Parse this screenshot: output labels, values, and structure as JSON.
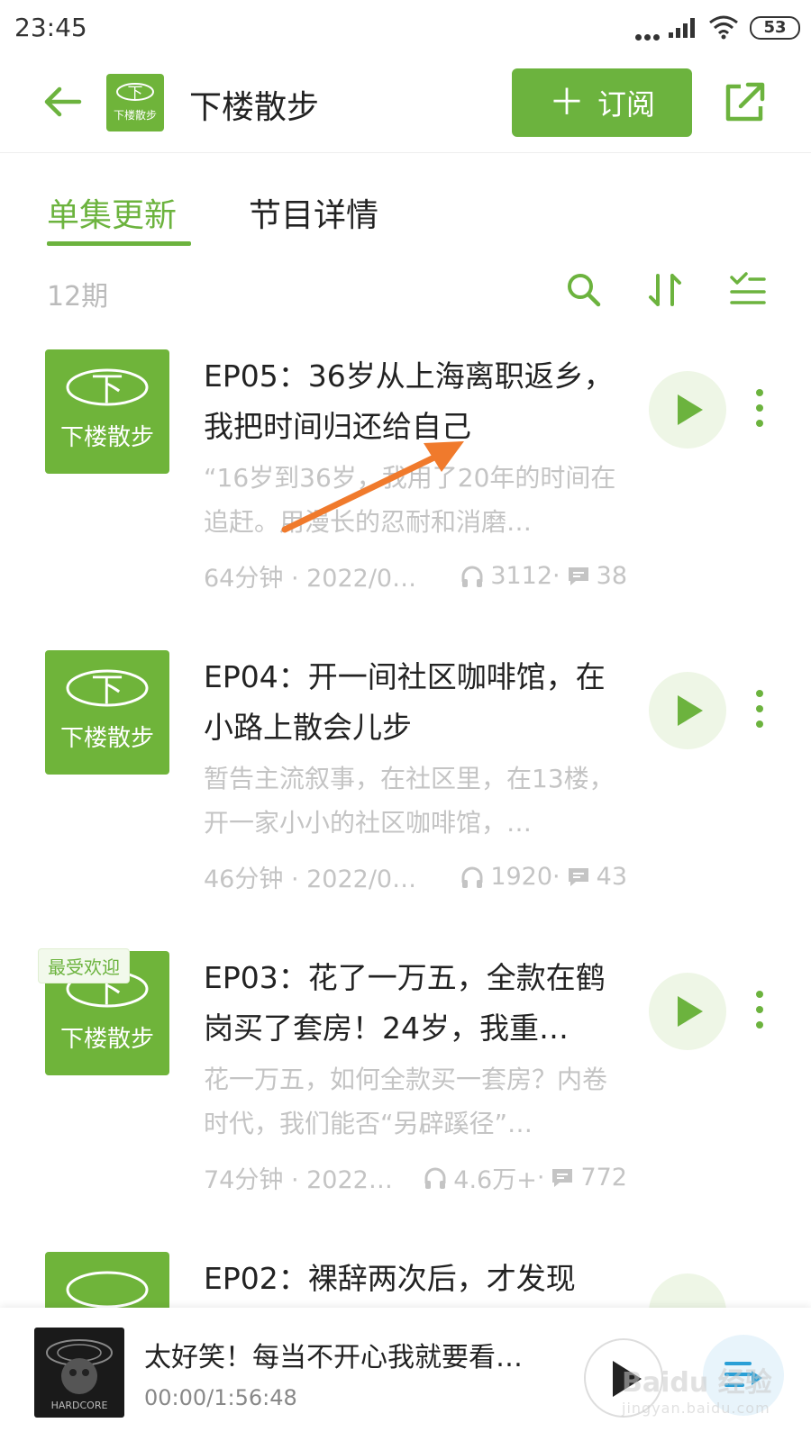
{
  "status_bar": {
    "time": "23:45",
    "battery": "53",
    "icons": [
      "dots-icon",
      "signal-icon",
      "wifi-icon",
      "battery-icon"
    ]
  },
  "header": {
    "title": "下楼散步",
    "subscribe_label": "订阅",
    "logo_text": "下楼散步",
    "logo_glyph": "下"
  },
  "tabs": [
    {
      "label": "单集更新",
      "active": true
    },
    {
      "label": "节目详情",
      "active": false
    }
  ],
  "toolbar": {
    "count": "12期",
    "icons": [
      "search-icon",
      "sort-icon",
      "filter-icon"
    ]
  },
  "episodes": [
    {
      "title": "EP05：36岁从上海离职返乡，我把时间归还给自己",
      "desc": "“16岁到36岁，我用了20年的时间在追赶。用漫长的忍耐和消磨…",
      "duration": "64分钟 · 2022/0…",
      "plays": "3112",
      "comments": "38",
      "badge": ""
    },
    {
      "title": "EP04：开一间社区咖啡馆，在小路上散会儿步",
      "desc": "暂告主流叙事，在社区里，在13楼，开一家小小的社区咖啡馆，…",
      "duration": "46分钟 · 2022/0…",
      "plays": "1920",
      "comments": "43",
      "badge": ""
    },
    {
      "title": "EP03：花了一万五，全款在鹤岗买了套房！24岁，我重…",
      "desc": "花一万五，如何全款买一套房？内卷时代，我们能否“另辟蹊径”…",
      "duration": "74分钟 · 2022…",
      "plays": "4.6万+",
      "comments": "772",
      "badge": "最受欢迎"
    },
    {
      "title": "EP02：裸辞两次后，才发现",
      "desc": "",
      "duration": "",
      "plays": "",
      "comments": "",
      "badge": ""
    }
  ],
  "player": {
    "title": "太好笑！每当不开心我就要看…",
    "time": "00:00/1:56:48",
    "cover_text": "HARDCORE"
  },
  "watermark": {
    "brand": "Baidu 经验",
    "url": "jingyan.baidu.com"
  },
  "colors": {
    "accent": "#6cb33e",
    "text": "#222222",
    "muted": "#c4c4c4",
    "annotation": "#f07a2c"
  }
}
